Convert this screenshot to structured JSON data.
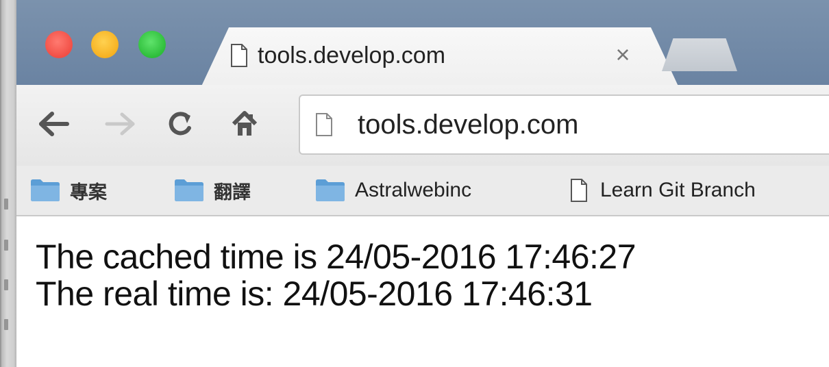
{
  "tab": {
    "title": "tools.develop.com",
    "close_label": "×"
  },
  "toolbar": {
    "url": "tools.develop.com"
  },
  "bookmarks": [
    {
      "label": "專案",
      "icon": "folder-icon"
    },
    {
      "label": "翻譯",
      "icon": "folder-icon"
    },
    {
      "label": "Astralwebinc",
      "icon": "folder-icon"
    },
    {
      "label": "Learn Git Branch",
      "icon": "page-icon"
    }
  ],
  "content": {
    "line1": "The cached time is 24/05-2016 17:46:27",
    "line2": "The real time is: 24/05-2016 17:46:31"
  },
  "colors": {
    "titlebar": "#6a83a2",
    "close": "#f14e45",
    "minimize": "#f6b121",
    "zoom": "#2dbd3a"
  }
}
